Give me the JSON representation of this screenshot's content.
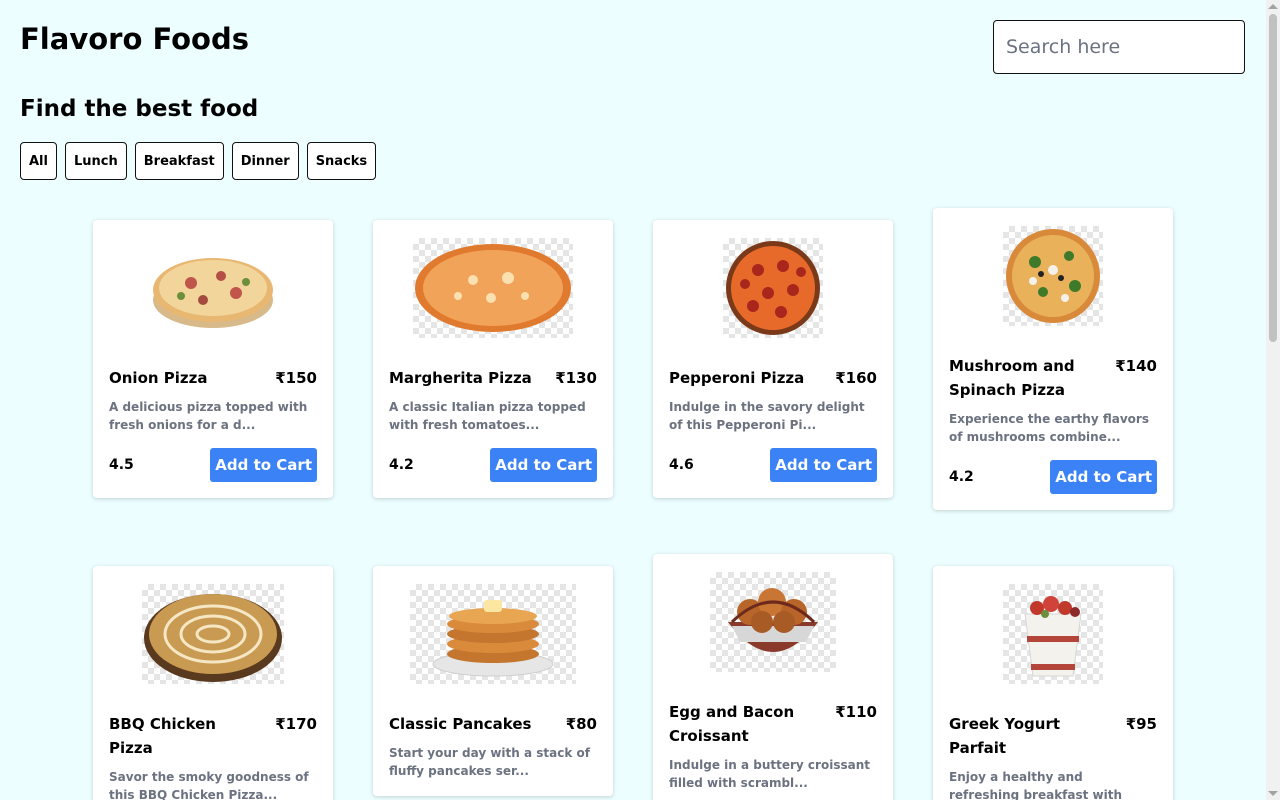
{
  "header": {
    "brand": "Flavoro Foods",
    "search_placeholder": "Search here"
  },
  "subtitle": "Find the best food",
  "filters": [
    "All",
    "Lunch",
    "Breakfast",
    "Dinner",
    "Snacks"
  ],
  "cart_label": "Add to Cart",
  "colors": {
    "background": "#ecfeff",
    "accent": "#3b82f6"
  },
  "items": [
    {
      "name": "Onion Pizza",
      "price": "₹150",
      "desc": "A delicious pizza topped with fresh onions for a d...",
      "rating": "4.5",
      "image": "pizza-icon"
    },
    {
      "name": "Margherita Pizza",
      "price": "₹130",
      "desc": "A classic Italian pizza topped with fresh tomatoes...",
      "rating": "4.2",
      "image": "pizza-icon"
    },
    {
      "name": "Pepperoni Pizza",
      "price": "₹160",
      "desc": "Indulge in the savory delight of this Pepperoni Pi...",
      "rating": "4.6",
      "image": "pizza-icon"
    },
    {
      "name": "Mushroom and Spinach Pizza",
      "price": "₹140",
      "desc": "Experience the earthy flavors of mushrooms combine...",
      "rating": "4.2",
      "image": "pizza-icon"
    },
    {
      "name": "BBQ Chicken Pizza",
      "price": "₹170",
      "desc": "Savor the smoky goodness of this BBQ Chicken Pizza...",
      "rating": "",
      "image": "pizza-icon"
    },
    {
      "name": "Classic Pancakes",
      "price": "₹80",
      "desc": "Start your day with a stack of fluffy pancakes ser...",
      "rating": "",
      "image": "pancake-icon"
    },
    {
      "name": "Egg and Bacon Croissant",
      "price": "₹110",
      "desc": "Indulge in a buttery croissant filled with scrambl...",
      "rating": "",
      "image": "croissant-basket-icon"
    },
    {
      "name": "Greek Yogurt Parfait",
      "price": "₹95",
      "desc": "Enjoy a healthy and refreshing breakfast with laye...",
      "rating": "",
      "image": "parfait-icon"
    }
  ]
}
